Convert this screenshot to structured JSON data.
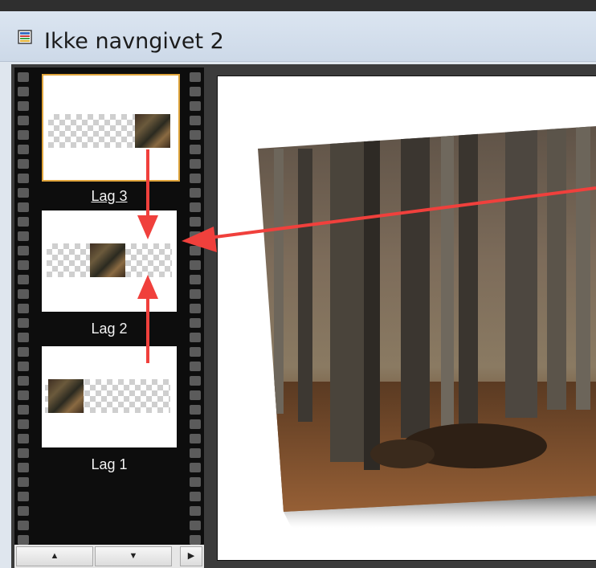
{
  "window": {
    "title": "Ikke navngivet 2",
    "icon": "document-icon"
  },
  "layers": [
    {
      "label": "Lag 3",
      "selected": true
    },
    {
      "label": "Lag 2",
      "selected": false
    },
    {
      "label": "Lag 1",
      "selected": false
    }
  ],
  "nav": {
    "up": "▲",
    "down": "▼",
    "right": "▶"
  },
  "colors": {
    "arrow": "#f0403c",
    "selection": "#e0a53c",
    "strip": "#0d0d0d"
  }
}
